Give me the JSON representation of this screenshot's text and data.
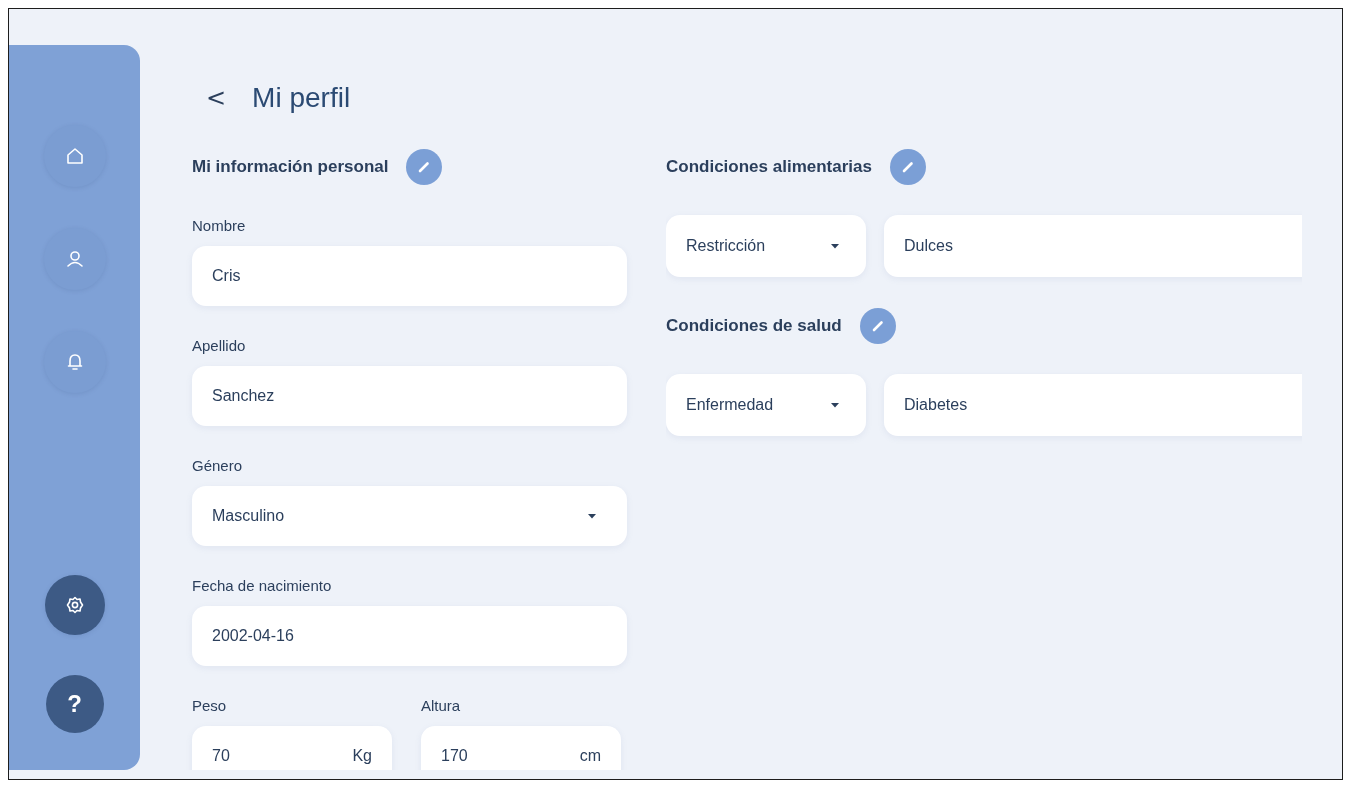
{
  "sidebar": {
    "items": [
      {
        "selected": false
      },
      {
        "selected": false
      },
      {
        "selected": false
      },
      {
        "selected": true
      }
    ],
    "help": {
      "label": "?"
    }
  },
  "header": {
    "back": "<",
    "title": "Mi perfil"
  },
  "personal": {
    "title": "Mi información personal",
    "fields": [
      {
        "kind": "text",
        "label": "Nombre",
        "value": "Cris"
      },
      {
        "kind": "text",
        "label": "Apellido",
        "value": "Sanchez"
      },
      {
        "kind": "select",
        "label": "Género",
        "value": "Masculino"
      },
      {
        "kind": "text",
        "label": "Fecha de nacimiento",
        "value": "2002-04-16"
      }
    ],
    "measurements": [
      {
        "label": "Peso",
        "value": "70",
        "unit": "Kg"
      },
      {
        "label": "Altura",
        "value": "170",
        "unit": "cm"
      }
    ]
  },
  "conditions": [
    {
      "title": "Condiciones alimentarias",
      "rows": [
        {
          "category": "Restricción",
          "value": "Dulces"
        }
      ]
    },
    {
      "title": "Condiciones de salud",
      "rows": [
        {
          "category": "Enfermedad",
          "value": "Diabetes"
        }
      ]
    }
  ]
}
